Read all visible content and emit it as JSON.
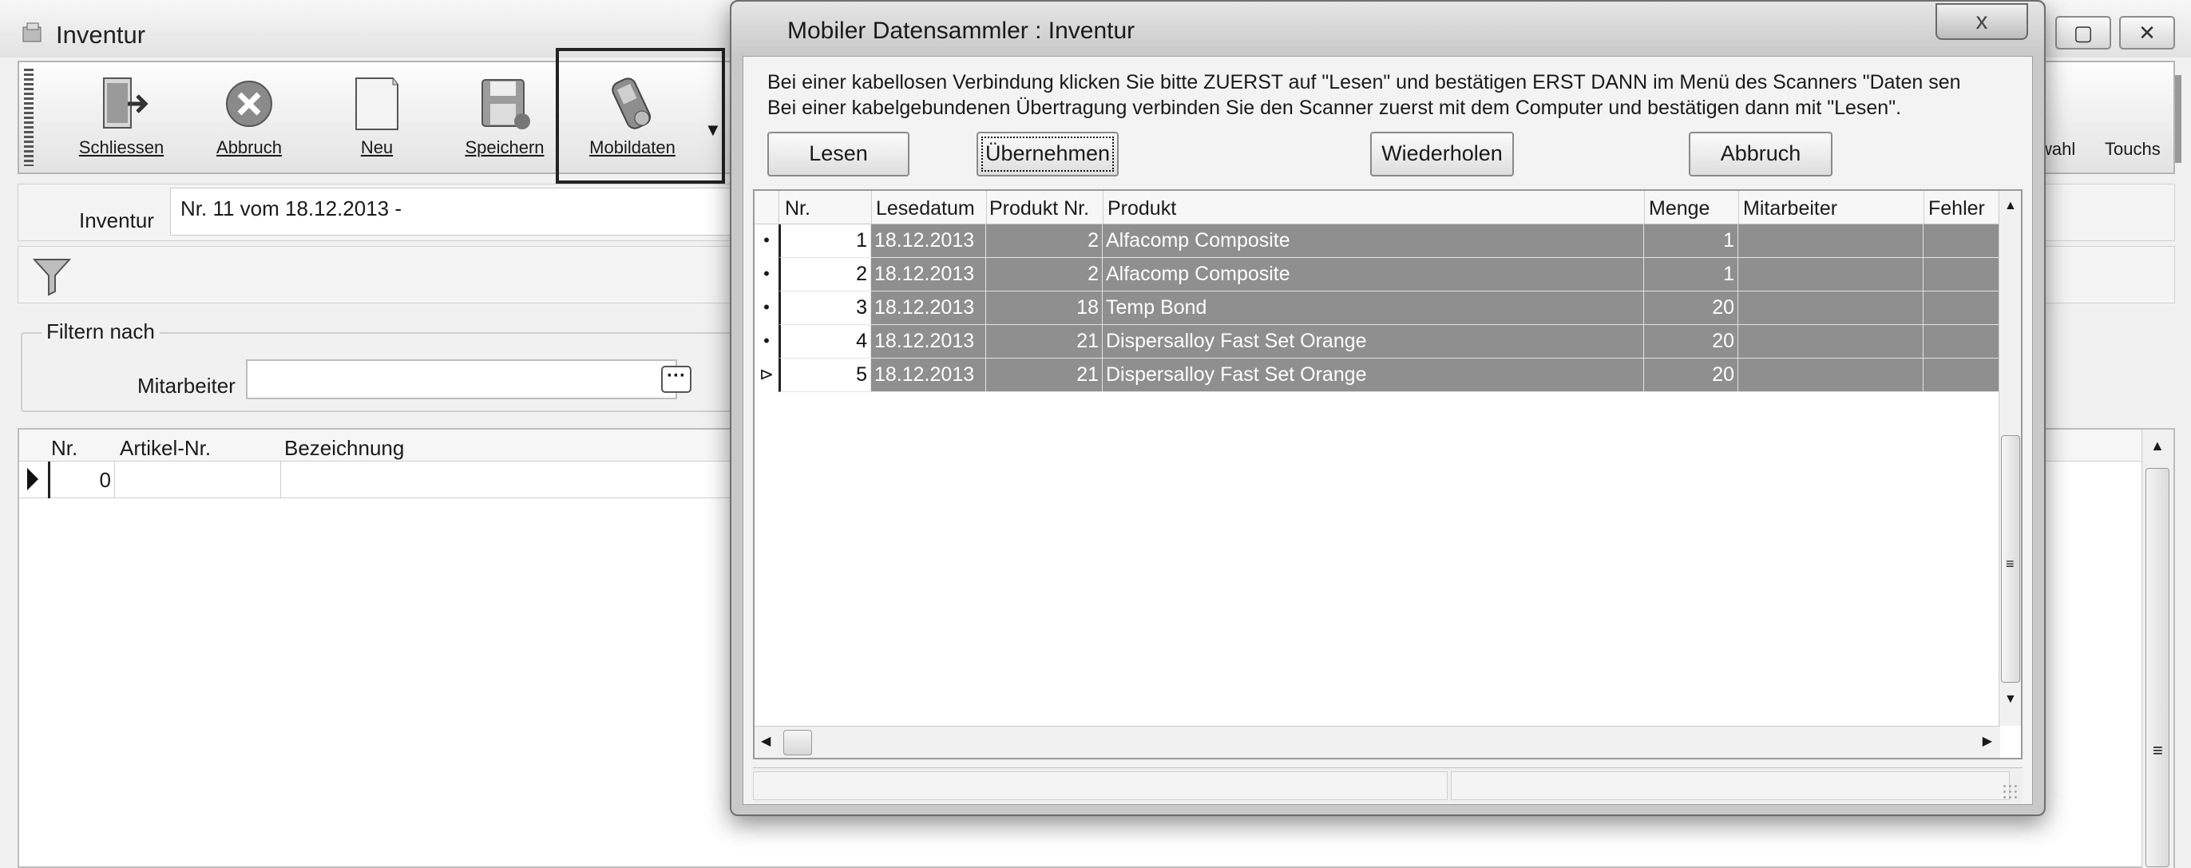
{
  "main": {
    "title": "Inventur",
    "toolbar": {
      "close_label": "Schliessen",
      "abort_label": "Abbruch",
      "new_label": "Neu",
      "save_label": "Speichern",
      "mobile_label": "Mobildaten",
      "right_1": "wahl",
      "right_2": "Touchs"
    },
    "inventur_label": "Inventur",
    "inventur_value": "Nr. 11 vom 18.12.2013 -",
    "filter": {
      "group_label": "Filtern nach",
      "mitarbeiter_label": "Mitarbeiter",
      "mitarbeiter_value": "",
      "browse_label": "···"
    },
    "grid": {
      "columns": [
        "Nr.",
        "Artikel-Nr.",
        "Bezeichnung"
      ],
      "rows": [
        {
          "nr": "0",
          "artikel": "",
          "bezeichnung": ""
        }
      ]
    }
  },
  "dialog": {
    "title": "Mobiler Datensammler : Inventur",
    "close_label": "x",
    "instruction_1": "Bei einer kabellosen Verbindung klicken Sie bitte ZUERST auf \"Lesen\" und bestätigen ERST DANN im Menü des Scanners \"Daten sen",
    "instruction_2": "Bei einer kabelgebundenen Übertragung verbinden Sie den Scanner zuerst mit dem Computer und bestätigen dann mit \"Lesen\".",
    "buttons": {
      "lesen": "Lesen",
      "uebernehmen": "Übernehmen",
      "wiederholen": "Wiederholen",
      "abbruch": "Abbruch"
    },
    "grid": {
      "columns": [
        "Nr.",
        "Lesedatum",
        "Produkt Nr.",
        "Produkt",
        "Menge",
        "Mitarbeiter",
        "Fehler"
      ],
      "rows": [
        {
          "indicator": "•",
          "nr": "1",
          "date": "18.12.2013",
          "pnr": "2",
          "product": "Alfacomp Composite",
          "menge": "1",
          "mitarbeiter": "",
          "fehler": ""
        },
        {
          "indicator": "•",
          "nr": "2",
          "date": "18.12.2013",
          "pnr": "2",
          "product": "Alfacomp Composite",
          "menge": "1",
          "mitarbeiter": "",
          "fehler": ""
        },
        {
          "indicator": "•",
          "nr": "3",
          "date": "18.12.2013",
          "pnr": "18",
          "product": "Temp Bond",
          "menge": "20",
          "mitarbeiter": "",
          "fehler": ""
        },
        {
          "indicator": "•",
          "nr": "4",
          "date": "18.12.2013",
          "pnr": "21",
          "product": "Dispersalloy Fast Set Orange",
          "menge": "20",
          "mitarbeiter": "",
          "fehler": ""
        },
        {
          "indicator": "⊳",
          "nr": "5",
          "date": "18.12.2013",
          "pnr": "21",
          "product": "Dispersalloy Fast Set Orange",
          "menge": "20",
          "mitarbeiter": "",
          "fehler": ""
        }
      ]
    }
  },
  "colors": {
    "selected_row": "#8f8f8f",
    "window_bg": "#f1f1f1"
  }
}
